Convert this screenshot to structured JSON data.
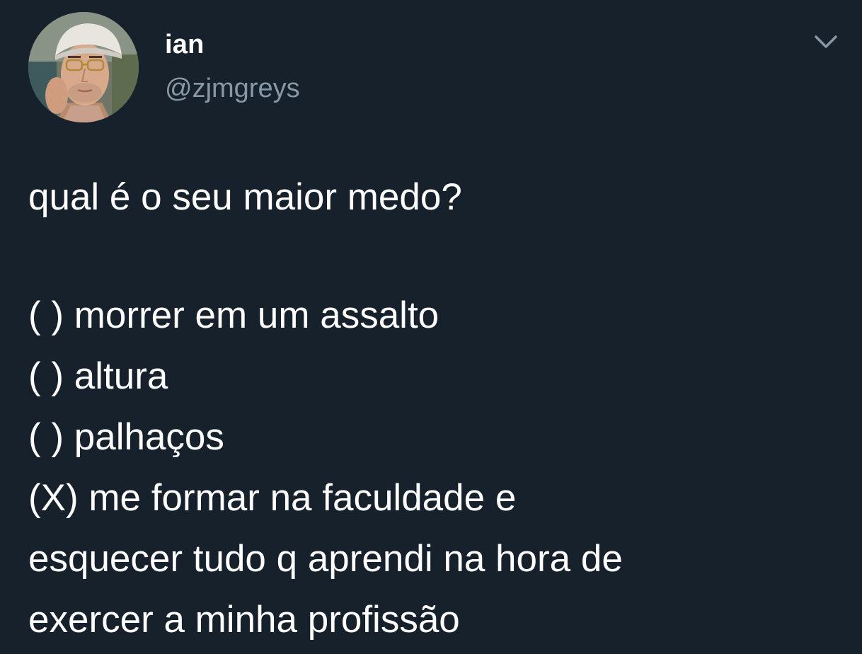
{
  "tweet": {
    "author": {
      "display_name": "ian",
      "handle": "@zjmgreys",
      "avatar_icon": "profile-photo"
    },
    "menu_icon": "chevron-down-icon",
    "text_lines": [
      "qual é o seu maior medo?",
      "",
      "( ) morrer em um assalto",
      "( ) altura",
      "( ) palhaços",
      "(X) me formar na faculdade e",
      "esquecer tudo q aprendi na hora de",
      "exercer a minha profissão"
    ]
  },
  "colors": {
    "background": "#15202b",
    "text": "#ffffff",
    "secondary_text": "#8899a6",
    "caret": "#8899a6"
  }
}
